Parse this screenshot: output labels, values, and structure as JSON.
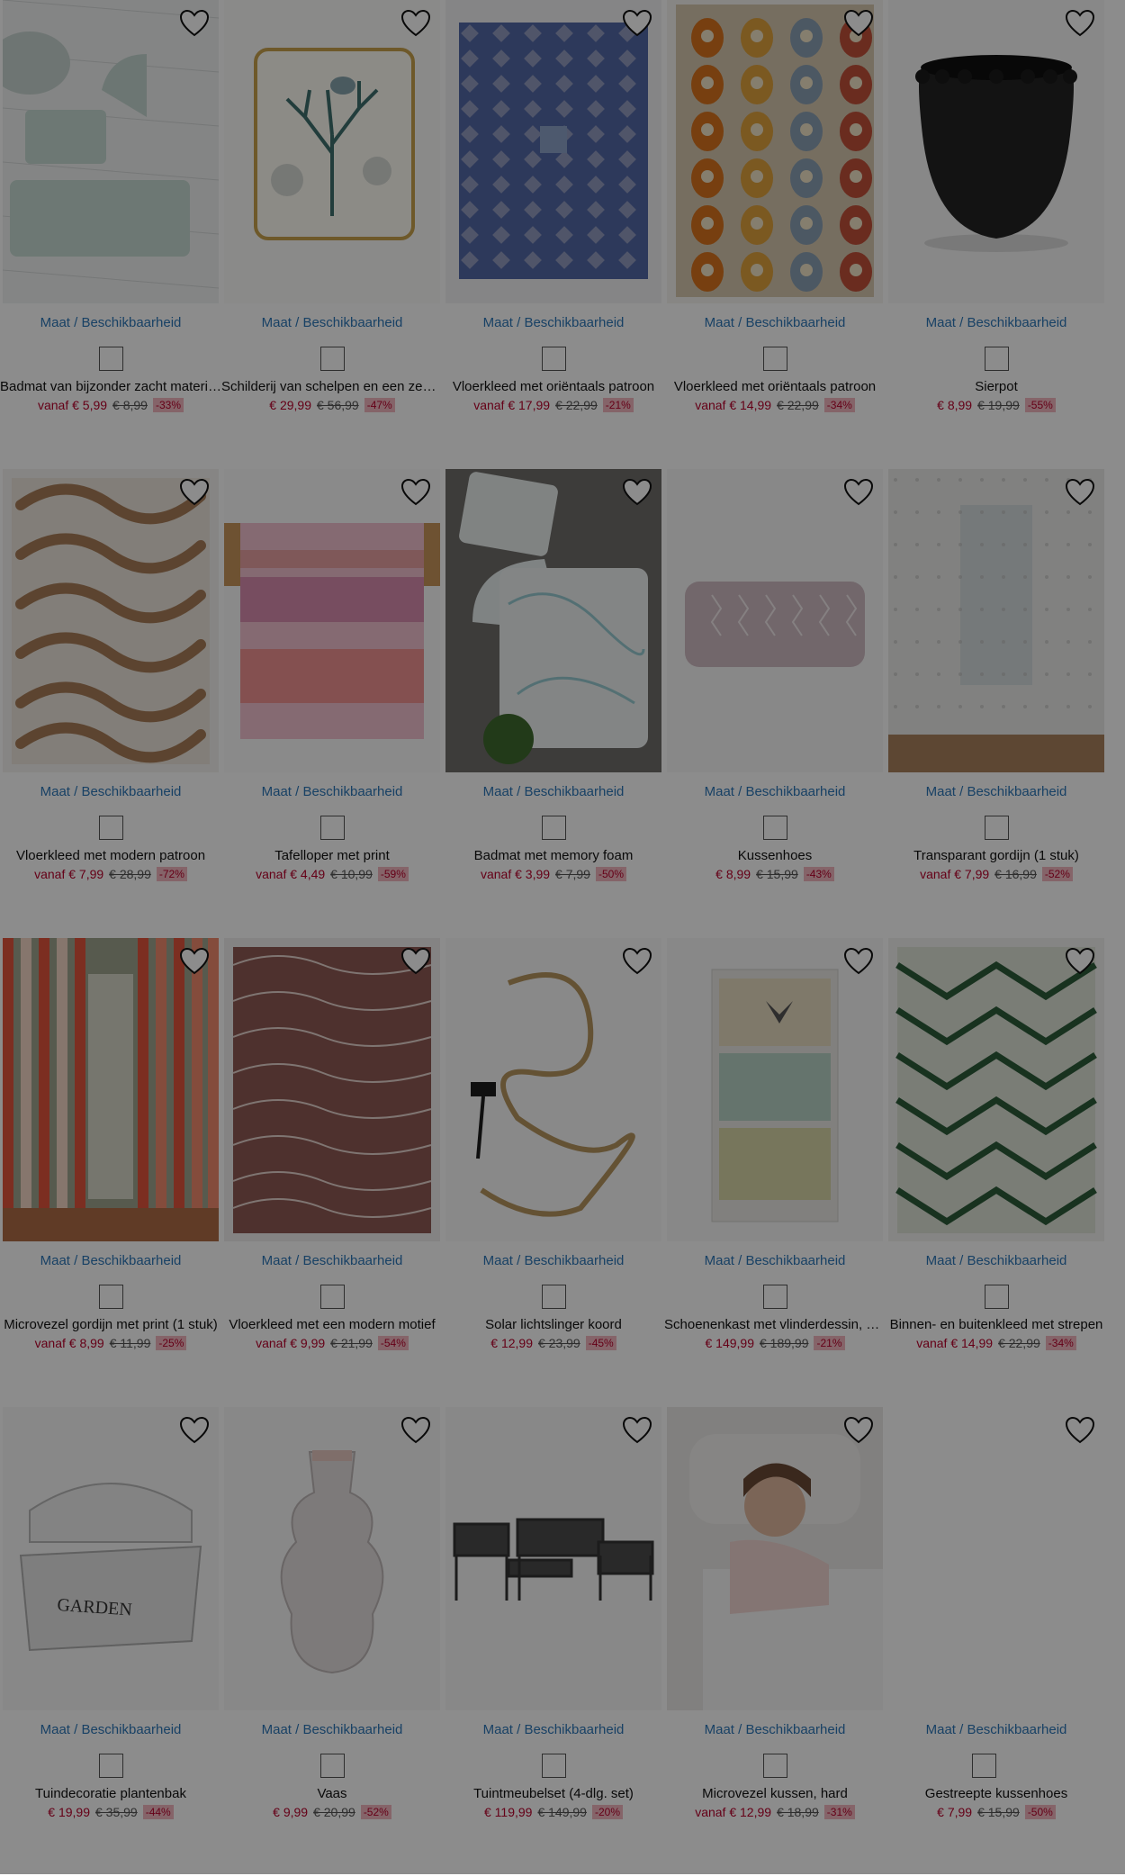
{
  "maat_label": "Maat / Beschikbaarheid",
  "products": [
    {
      "title": "Badmat van bijzonder zacht materiaal",
      "now": "vanaf € 5,99",
      "old": "€ 8,99",
      "disc": "-33%",
      "art": "bathmat-mint",
      "swatches": [
        "#9fb6ae"
      ]
    },
    {
      "title": "Schilderij van schelpen en een zees…",
      "now": "€ 29,99",
      "old": "€ 56,99",
      "disc": "-47%",
      "art": "coral",
      "swatches": [
        "#6b8a87"
      ]
    },
    {
      "title": "Vloerkleed met oriëntaals patroon",
      "now": "vanaf € 17,99",
      "old": "€ 22,99",
      "disc": "-21%",
      "art": "rug-blue",
      "swatches": [
        "#3d5796"
      ]
    },
    {
      "title": "Vloerkleed met oriëntaals patroon",
      "now": "vanaf € 14,99",
      "old": "€ 22,99",
      "disc": "-34%",
      "art": "rug-paisley",
      "swatches": [
        "#c4754a"
      ]
    },
    {
      "title": "Sierpot",
      "now": "€ 8,99",
      "old": "€ 19,99",
      "disc": "-55%",
      "art": "pot",
      "swatches": [
        "#111111"
      ]
    },
    {
      "title": "Vloerkleed met modern patroon",
      "now": "vanaf € 7,99",
      "old": "€ 28,99",
      "disc": "-72%",
      "art": "rug-brown",
      "swatches": [
        "#b88a66"
      ]
    },
    {
      "title": "Tafelloper met print",
      "now": "vanaf € 4,49",
      "old": "€ 10,99",
      "disc": "-59%",
      "art": "runner",
      "swatches": [
        "#e97c8c"
      ]
    },
    {
      "title": "Badmat met memory foam",
      "now": "vanaf € 3,99",
      "old": "€ 7,99",
      "disc": "-50%",
      "art": "bathmat-marble",
      "swatches": [
        "#8fa6a2"
      ]
    },
    {
      "title": "Kussenhoes",
      "now": "€ 8,99",
      "old": "€ 15,99",
      "disc": "-43%",
      "art": "cushion",
      "swatches": [
        "#cbb7be"
      ]
    },
    {
      "title": "Transparant gordijn (1 stuk)",
      "now": "vanaf € 7,99",
      "old": "€ 16,99",
      "disc": "-52%",
      "art": "curtain-white",
      "swatches": [
        "#ececec"
      ]
    },
    {
      "title": "Microvezel gordijn met print (1 stuk)",
      "now": "vanaf € 8,99",
      "old": "€ 11,99",
      "disc": "-25%",
      "art": "curtain-red",
      "swatches": [
        "#c43d2c"
      ]
    },
    {
      "title": "Vloerkleed met een modern motief",
      "now": "vanaf € 9,99",
      "old": "€ 21,99",
      "disc": "-54%",
      "art": "rug-waves",
      "swatches": [
        "#8b4b46"
      ]
    },
    {
      "title": "Solar lichtslinger koord",
      "now": "€ 12,99",
      "old": "€ 23,99",
      "disc": "-45%",
      "art": "rope",
      "swatches": [
        "#d9c9a7"
      ]
    },
    {
      "title": "Schoenenkast met vlinderdessin, 3 …",
      "now": "€ 149,99",
      "old": "€ 189,99",
      "disc": "-21%",
      "art": "cabinet",
      "swatches": [
        "#d3d3cc"
      ]
    },
    {
      "title": "Binnen- en buitenkleed met strepen",
      "now": "vanaf € 14,99",
      "old": "€ 22,99",
      "disc": "-34%",
      "art": "rug-chevron",
      "swatches": [
        "#2c5a3a"
      ]
    },
    {
      "title": "Tuindecoratie plantenbak",
      "now": "€ 19,99",
      "old": "€ 35,99",
      "disc": "-44%",
      "art": "chest",
      "swatches": [
        "#dcdcdc"
      ]
    },
    {
      "title": "Vaas",
      "now": "€ 9,99",
      "old": "€ 20,99",
      "disc": "-52%",
      "art": "vase",
      "swatches": [
        "#d6cbc4"
      ]
    },
    {
      "title": "Tuintmeubelset (4-dlg. set)",
      "now": "€ 119,99",
      "old": "€ 149,99",
      "disc": "-20%",
      "art": "furniture",
      "swatches": [
        "#333333"
      ]
    },
    {
      "title": "Microvezel kussen, hard",
      "now": "vanaf € 12,99",
      "old": "€ 18,99",
      "disc": "-31%",
      "art": "pillow",
      "swatches": [
        "#eeeeee"
      ]
    },
    {
      "title": "Gestreepte kussenhoes",
      "now": "€ 7,99",
      "old": "€ 15,99",
      "disc": "-50%",
      "art": "empty",
      "swatches": [
        "#9c9ca0",
        "#d8a7bd"
      ]
    }
  ]
}
